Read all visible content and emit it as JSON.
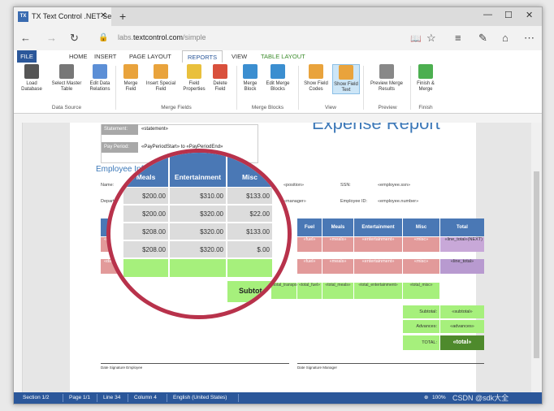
{
  "browser": {
    "tab_title": "TX Text Control .NET Se",
    "url_prefix": "labs.",
    "url_domain": "textcontrol.com",
    "url_path": "/simple"
  },
  "ribbon": {
    "tabs": [
      "FILE",
      "HOME",
      "INSERT",
      "PAGE LAYOUT",
      "REPORTS",
      "VIEW",
      "TABLE LAYOUT"
    ],
    "active_tab": "REPORTS",
    "buttons": {
      "load_db": "Load Database",
      "select_master": "Select Master Table",
      "edit_relations": "Edit Data Relations",
      "merge_field": "Merge Field",
      "insert_special": "Insert Special Field",
      "field_props": "Field Properties",
      "delete_field": "Delete Field",
      "merge_block": "Merge Block",
      "edit_merge_blocks": "Edit Merge Blocks",
      "show_field_codes": "Show Field Codes",
      "show_field_text": "Show Field Text",
      "preview_results": "Preview Merge Results",
      "finish_merge": "Finish & Merge"
    },
    "groups": [
      "Data Source",
      "Merge Fields",
      "Merge Blocks",
      "View",
      "Preview",
      "Finish"
    ]
  },
  "document": {
    "title": "Expense Report",
    "statement_label": "Statement:",
    "statement_value": "«statement»",
    "pay_period_label": "Pay Period:",
    "pay_period_value": "«PayPeriodStart» to «PayPeriodEnd»",
    "employee_info": "Employee Information",
    "name_label": "Name:",
    "department_label": "Department:",
    "position": "«position»",
    "manager": "«manager»",
    "ssn_label": "SSN:",
    "ssn_value": "«employee.ssn»",
    "employee_id_label": "Employee ID:",
    "employee_id_value": "«employee.number»",
    "table_headers": [
      "Date",
      "Fuel",
      "Meals",
      "Entertainment",
      "Misc",
      "Total"
    ],
    "row1": [
      "«date»",
      "«fuel»",
      "«meals»",
      "«entertainment»",
      "«misc»",
      "«line_total»(NEXT)"
    ],
    "row2": [
      "«date»",
      "«fuel»",
      "«meals»",
      "«entertainment»",
      "«misc»",
      "«line_total»"
    ],
    "subtotal_row": [
      "Subtotal",
      "«total_transport»",
      "«total_fuel»",
      "«total_meals»",
      "«total_entertainment»",
      "«total_misc»"
    ],
    "subtotal_label": "Subtotal:",
    "subtotal_value": "«subtotal»",
    "advances_label": "Advances:",
    "advances_value": "«advances»",
    "total_label": "TOTAL:",
    "total_value": "«total»",
    "sig_employee": "Date   Signature Employee",
    "sig_manager": "Date   Signature Manager"
  },
  "magnifier": {
    "headers": [
      "Meals",
      "Entertainment",
      "Misc"
    ],
    "info_title": "Employee Info",
    "rows": [
      [
        "$200.00",
        "$310.00",
        "$133.00"
      ],
      [
        "$200.00",
        "$320.00",
        "$22.00"
      ],
      [
        "$208.00",
        "$320.00",
        "$133.00"
      ],
      [
        "$208.00",
        "$320.00",
        "$.00"
      ]
    ],
    "subtotal": "Subtot"
  },
  "statusbar": {
    "section": "Section 1/2",
    "page": "Page 1/1",
    "line": "Line 34",
    "column": "Column 4",
    "language": "English (United States)",
    "zoom": "100%",
    "watermark": "CSDN @sdk大全"
  },
  "colors": {
    "accent": "#2b579a",
    "doc_blue": "#4a78b5",
    "field_red": "#e29a9a",
    "field_green": "#a6f07c",
    "ring": "#b8324b"
  }
}
